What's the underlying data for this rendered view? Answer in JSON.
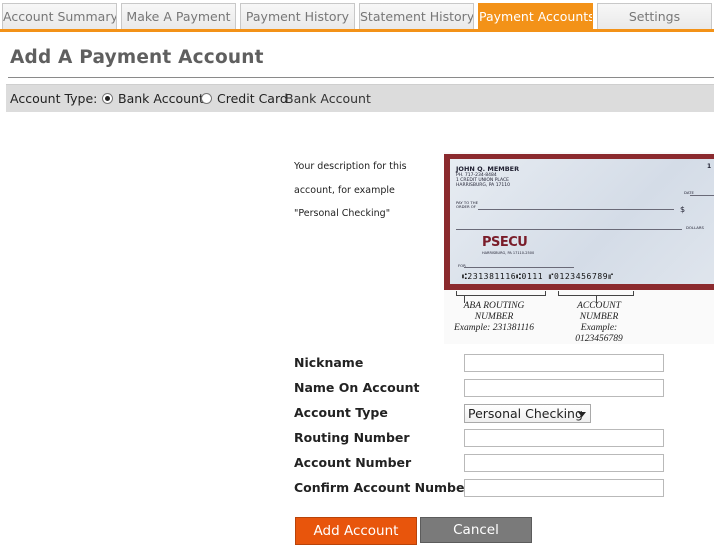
{
  "tabs": [
    {
      "label": "Account Summary",
      "active": false
    },
    {
      "label": "Make A Payment",
      "active": false
    },
    {
      "label": "Payment History",
      "active": false
    },
    {
      "label": "Statement History",
      "active": false
    },
    {
      "label": "Payment Accounts",
      "active": true
    },
    {
      "label": "Settings",
      "active": false
    }
  ],
  "colors": {
    "accent": "#f39218",
    "primary_button": "#e8550c",
    "secondary_button": "#7a7a7a"
  },
  "page_title": "Add A Payment Account",
  "account_type": {
    "label": "Account Type:",
    "options": [
      {
        "label": "Bank Account",
        "checked": true
      },
      {
        "label": "Credit Card",
        "checked": false
      }
    ],
    "selected_text": "Bank Account"
  },
  "description_text": "Your description for this account, for example \"Personal Checking\"",
  "check_image": {
    "name": "JOHN Q. MEMBER",
    "address": [
      "PH. 717-234-8484",
      "1 CREDIT UNION PLACE",
      "HARRISBURG, PA 17110"
    ],
    "pay_to": [
      "PAY TO THE",
      "ORDER OF"
    ],
    "date": "DATE",
    "dollar_sign": "$",
    "dollars": "DOLLARS",
    "check_number": "1",
    "brand": "PSECU",
    "branch": "HARRISBURG, PA 17110-2500",
    "for": "FOR",
    "micr": "⑆231381116⑆0111 ⑈0123456789⑈",
    "routing_label": [
      "ABA ROUTING",
      "NUMBER",
      "Example: 231381116"
    ],
    "account_label": [
      "ACCOUNT",
      "NUMBER",
      "Example:",
      "0123456789"
    ]
  },
  "form": {
    "nickname": {
      "label": "Nickname",
      "value": ""
    },
    "name_on_account": {
      "label": "Name On Account",
      "value": ""
    },
    "account_type": {
      "label": "Account Type",
      "selected": "Personal Checking"
    },
    "routing_number": {
      "label": "Routing Number",
      "value": ""
    },
    "account_number": {
      "label": "Account Number",
      "value": ""
    },
    "confirm_account_number": {
      "label": "Confirm Account Number",
      "value": ""
    }
  },
  "buttons": {
    "add": "Add Account",
    "cancel": "Cancel"
  }
}
